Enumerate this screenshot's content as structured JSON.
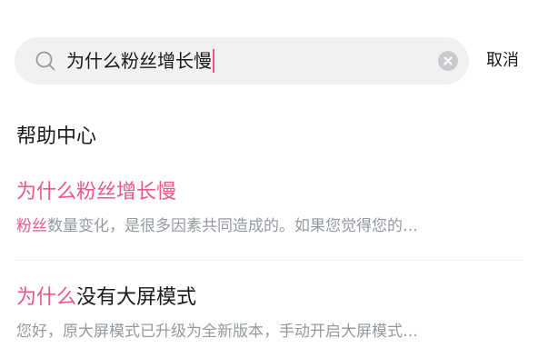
{
  "search": {
    "query": "为什么粉丝增长慢",
    "cancel_label": "取消"
  },
  "section": {
    "title": "帮助中心"
  },
  "results": [
    {
      "title_highlight": "为什么粉丝增长慢",
      "title_rest": "",
      "snippet_highlight": "粉丝",
      "snippet_rest": "数量变化，是很多因素共同造成的。如果您觉得您的…"
    },
    {
      "title_highlight": "为什么",
      "title_rest": "没有大屏模式",
      "snippet_highlight": "",
      "snippet_rest": "您好，原大屏模式已升级为全新版本，手动开启大屏模式…"
    }
  ],
  "colors": {
    "accent": "#e8588a",
    "text_primary": "#18191c",
    "text_secondary": "#9499a0",
    "search_bg": "#f1f1f2"
  },
  "icons": {
    "search": "search-icon",
    "clear": "clear-icon"
  }
}
